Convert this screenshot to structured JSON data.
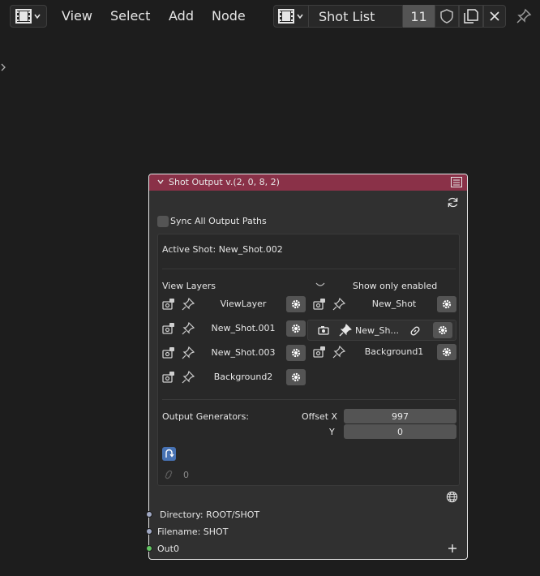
{
  "header": {
    "menus": [
      "View",
      "Select",
      "Add",
      "Node"
    ],
    "node_tree_name": "Shot List",
    "user_count": "11"
  },
  "node": {
    "title": "Shot Output v.(2, 0, 8, 2)",
    "sync_label": "Sync All Output Paths",
    "active_shot": "Active Shot: New_Shot.002",
    "view_layers_label": "View Layers",
    "show_only_enabled": "Show only enabled",
    "left_layers": [
      "ViewLayer",
      "New_Shot.001",
      "New_Shot.003",
      "Background2"
    ],
    "right_layers": [
      "New_Shot",
      "New_Sh...",
      "Background1"
    ],
    "output_generators": "Output Generators:",
    "offset_x_label": "Offset X",
    "offset_x": "997",
    "offset_y_label": "Y",
    "offset_y": "0",
    "link_count": "0",
    "directory": "Directory: ROOT/SHOT",
    "filename": "Filename: SHOT",
    "out0": "Out0"
  },
  "colors": {
    "node_header": "#8a3148",
    "node_body": "#303030",
    "panel_bg": "#282828",
    "accent_blue": "#4772b3",
    "socket_gray": "#a1a9c4",
    "socket_green": "#63c763"
  }
}
